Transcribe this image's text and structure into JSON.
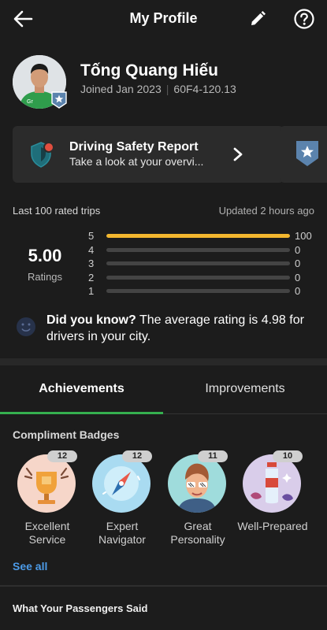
{
  "header": {
    "title": "My Profile",
    "back_icon": "arrow-left-icon",
    "edit_icon": "pencil-icon",
    "help_icon": "question-circle-icon"
  },
  "profile": {
    "name": "Tống Quang Hiếu",
    "joined": "Joined Jan 2023",
    "plate": "60F4-120.13",
    "avatar_icon": "driver-avatar",
    "badge_icon": "star-badge-icon"
  },
  "safety_card": {
    "title": "Driving Safety Report",
    "subtitle": "Take a look at your overvi...",
    "icon": "shield-icon",
    "chevron_icon": "chevron-right-icon"
  },
  "ratings": {
    "header_label": "Last 100 rated trips",
    "updated": "Updated 2 hours ago",
    "score": "5.00",
    "score_label": "Ratings",
    "rows": [
      {
        "star": "5",
        "count": "100",
        "fraction": 1.0
      },
      {
        "star": "4",
        "count": "0",
        "fraction": 0
      },
      {
        "star": "3",
        "count": "0",
        "fraction": 0
      },
      {
        "star": "2",
        "count": "0",
        "fraction": 0
      },
      {
        "star": "1",
        "count": "0",
        "fraction": 0
      }
    ]
  },
  "did_you_know": {
    "bold": "Did you know?",
    "text": " The average rating is 4.98 for drivers in your city.",
    "icon": "smiley-icon"
  },
  "tabs": {
    "achievements": "Achievements",
    "improvements": "Improvements"
  },
  "compliments": {
    "title": "Compliment Badges",
    "badges": [
      {
        "count": "12",
        "label": "Excellent Service",
        "icon": "trophy-icon"
      },
      {
        "count": "12",
        "label": "Expert Navigator",
        "icon": "compass-icon"
      },
      {
        "count": "11",
        "label": "Great Personality",
        "icon": "sunglasses-person-icon"
      },
      {
        "count": "10",
        "label": "Well-Prepared",
        "icon": "water-bottle-icon"
      }
    ],
    "see_all": "See all"
  },
  "passengers": {
    "title": "What Your Passengers Said"
  },
  "colors": {
    "background": "#1c1c1c",
    "accent_green": "#35b04f",
    "bar_yellow": "#f3b72f",
    "link_blue": "#4c9be8"
  }
}
